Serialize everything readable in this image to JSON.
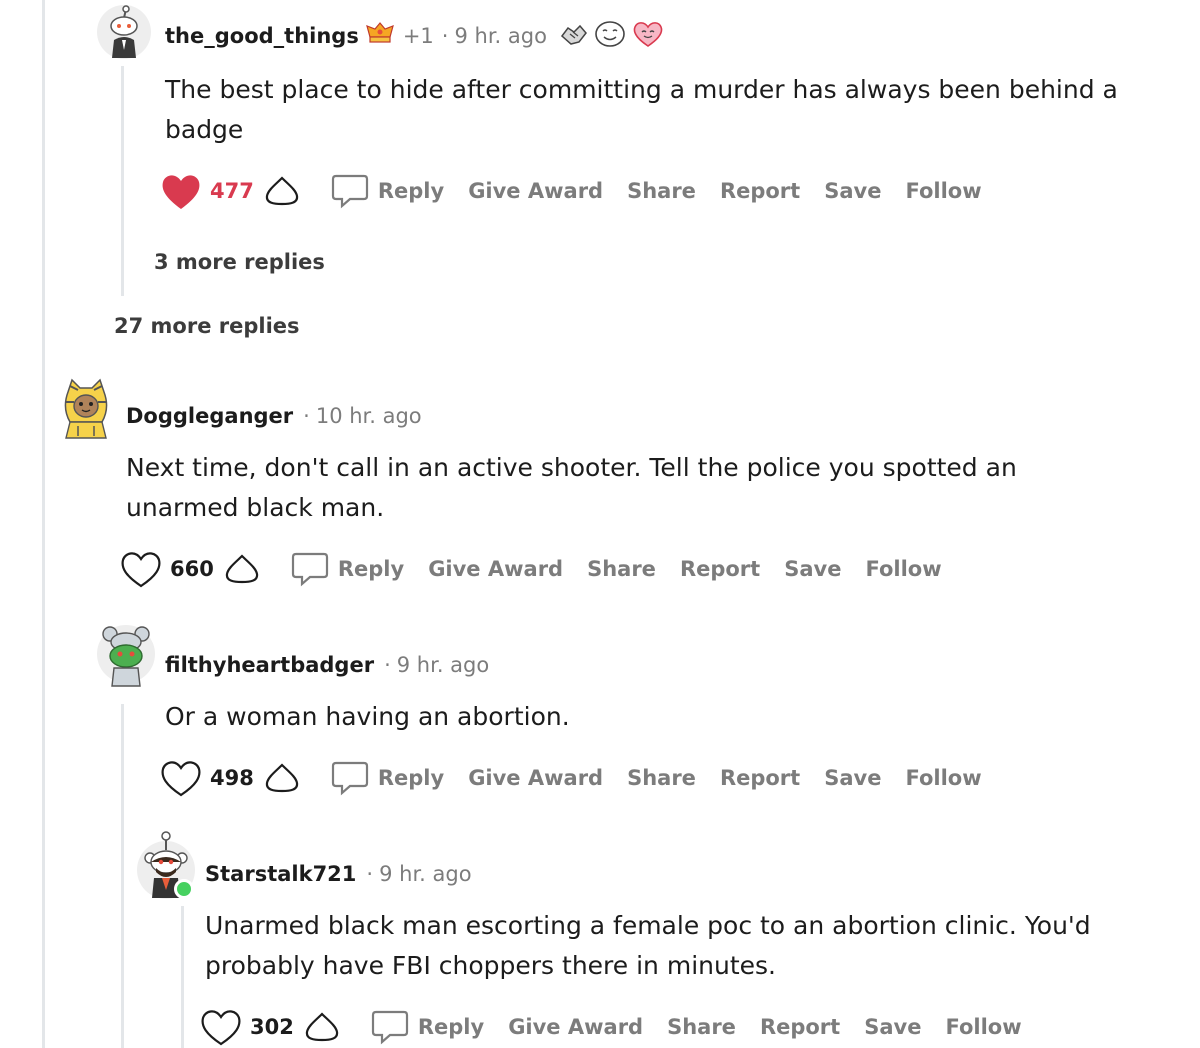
{
  "comments": [
    {
      "username": "the_good_things",
      "award_count": "+1",
      "dot": "·",
      "time": "9 hr. ago",
      "body": "The best place to hide after committing a murder has always been behind a badge",
      "score": "477",
      "liked": true,
      "more_replies": "3 more replies",
      "icons": [
        "award-badge-icon",
        "handshake-icon",
        "smile-face-icon",
        "heart-face-icon"
      ]
    },
    {
      "username": "Doggleganger",
      "dot": "·",
      "time": "10 hr. ago",
      "body": "Next time, don't call in an active shooter. Tell the police you spotted an unarmed black man.",
      "score": "660",
      "liked": false
    },
    {
      "username": "filthyheartbadger",
      "dot": "·",
      "time": "9 hr. ago",
      "body": "Or a woman having an abortion.",
      "score": "498",
      "liked": false
    },
    {
      "username": "Starstalk721",
      "dot": "·",
      "time": "9 hr. ago",
      "body": "Unarmed black man escorting a female poc to an abortion clinic. You'd probably have FBI choppers there in minutes.",
      "score": "302",
      "liked": false,
      "online": true
    }
  ],
  "parent_more_replies": "27 more replies",
  "action_labels": {
    "reply": "Reply",
    "give_award": "Give Award",
    "share": "Share",
    "report": "Report",
    "save": "Save",
    "follow": "Follow"
  },
  "colors": {
    "liked_heart": "#d93a4f",
    "muted_text": "#7c7c7c",
    "thread_line": "#e3e6e9",
    "online_dot": "#46d160"
  }
}
